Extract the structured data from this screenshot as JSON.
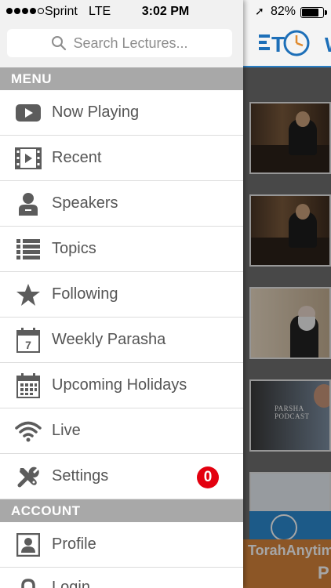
{
  "status_bar": {
    "carrier": "Sprint",
    "network": "LTE",
    "time": "3:02 PM",
    "battery": "82%",
    "battery_level": 0.82,
    "signal_bars": 4
  },
  "search": {
    "placeholder": "Search Lectures..."
  },
  "sections": {
    "menu": "MENU",
    "account": "ACCOUNT"
  },
  "menu": {
    "now_playing": "Now Playing",
    "recent": "Recent",
    "speakers": "Speakers",
    "topics": "Topics",
    "following": "Following",
    "weekly_parasha": "Weekly Parasha",
    "weekly_parasha_day": "7",
    "upcoming_holidays": "Upcoming Holidays",
    "live": "Live",
    "settings": "Settings",
    "settings_badge": "0"
  },
  "account": {
    "profile": "Profile",
    "login": "Login"
  },
  "background": {
    "brand_letter": "W",
    "thumb4_text": "PARSHA PODCAST",
    "banner_text": "TorahAnytime",
    "banner_letter": "P"
  },
  "colors": {
    "icon_gray": "#5c5c5c",
    "section_bg": "#a8a8a8",
    "badge_red": "#e3000f",
    "brand_blue": "#1d6fb8"
  },
  "icons": {
    "now_playing": "play-video-icon",
    "recent": "film-strip-icon",
    "speakers": "person-icon",
    "topics": "list-icon",
    "following": "star-icon",
    "weekly_parasha": "calendar-day-icon",
    "upcoming_holidays": "calendar-grid-icon",
    "live": "wifi-icon",
    "settings": "tools-icon",
    "profile": "profile-card-icon",
    "login": "lock-icon",
    "search": "search-icon"
  }
}
